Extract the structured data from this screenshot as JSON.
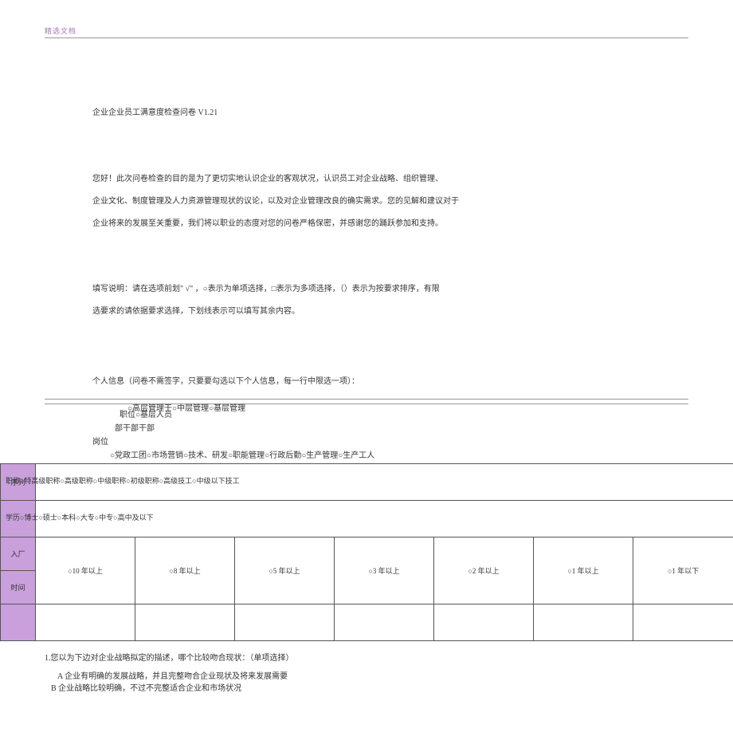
{
  "header": {
    "label": "精选文档"
  },
  "title": "企业企业员工满意度检查问卷 V1.21",
  "intro": {
    "p1": "您好！此次问卷检查的目的是为了更切实地认识企业的客观状况，认识员工对企业战略、组织管理、",
    "p2": "企业文化、制度管理及人力资源管理现状的议论，以及对企业管理改良的确实需求。您的见解和建议对于",
    "p3": "企业将来的发展至关重要，我们将以职业的态度对您的问卷严格保密，并感谢您的踊跃参加和支持。"
  },
  "instruction": {
    "p1": "填写说明：请在选项前划\" √\" ，○表示为单项选择，□表示为多项选择，（）表示为按要求排序，有限",
    "p2": "选要求的请依据要求选择，下划线表示可以填写其余内容。"
  },
  "personal": {
    "heading": "个人信息（问卷不需签字，只要要勾选以下个人信息，每一行中限选一项）：",
    "position_line": "○高层管理干○中层管理○基层管理",
    "position_label": "职位○基层人员",
    "position_sub": "部干部干部",
    "job_label": "岗位",
    "job_options": "○党政工团○市场营销○技术、研发○职能管理○行政后勤○生产管理○生产工人",
    "seq_label": "序列",
    "title_line": "职称○特高级职称○高级职称○中级职称○初级职称○高级技工○中级以下技工",
    "edu_line": "学历○博士○硕士○本科○大专○中专○高中及以下",
    "entry_label1": "入厂",
    "entry_label2": "时间",
    "tenure": [
      "○10 年以上",
      "○8 年以上",
      "○5 年以上",
      "○3 年以上",
      "○2 年以上",
      "○1 年以上",
      "○1 年以下"
    ]
  },
  "q1": {
    "title": "1.您以为下边对企业战略拟定的描述，哪个比较吻合现状：（单项选择）",
    "optA": "A 企业有明确的发展战略，并且完整吻合企业现状及将来发展需要",
    "optB": "B 企业战略比较明确，不过不完整适合企业和市场状况"
  }
}
